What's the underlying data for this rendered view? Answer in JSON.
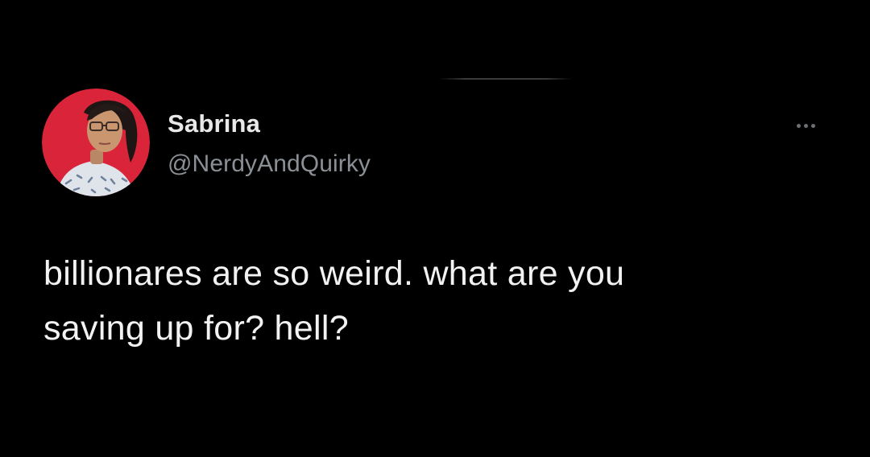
{
  "tweet": {
    "author": {
      "display_name": "Sabrina",
      "handle": "@NerdyAndQuirky",
      "avatar_icon": "profile-photo"
    },
    "more_icon": "more-horizontal-icon",
    "text_lines": [
      "billionares are so weird. what are you",
      "saving up for? hell?"
    ]
  },
  "colors": {
    "background": "#000000",
    "name_text": "#e8e8e8",
    "handle_text": "#8b9096",
    "body_text": "#f2f2f2",
    "avatar_background": "#d9243a"
  }
}
